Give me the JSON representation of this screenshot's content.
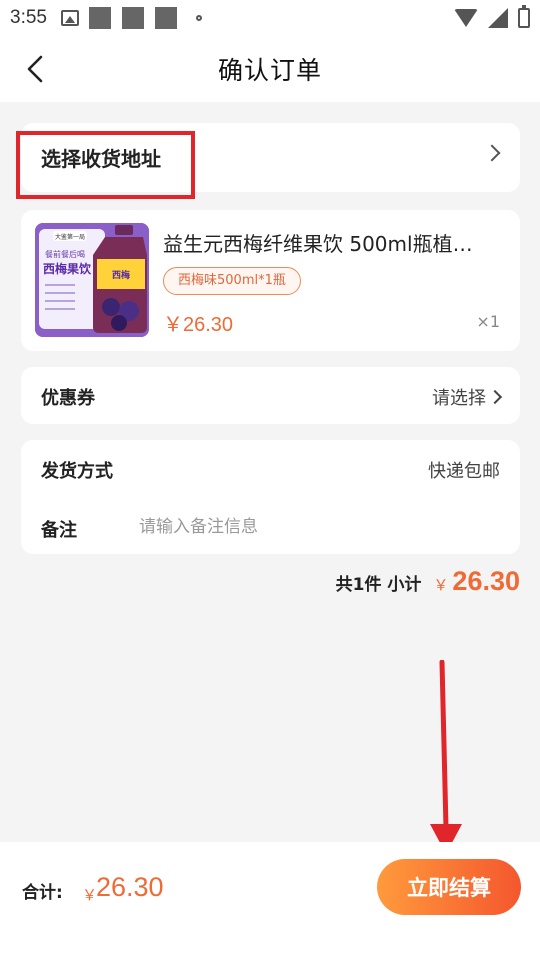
{
  "status_bar": {
    "time": "3:55"
  },
  "header": {
    "title": "确认订单"
  },
  "address": {
    "label": "选择收货地址"
  },
  "product": {
    "name": "益生元西梅纤维果饮 500ml瓶植…",
    "spec": "西梅味500ml*1瓶",
    "price": "￥26.30",
    "quantity": "×1",
    "image_texts": {
      "badge": "大鉴第一局",
      "line1": "餐前餐后喝",
      "line2": "西梅果饮"
    }
  },
  "coupon": {
    "label": "优惠券",
    "value": "请选择"
  },
  "shipping": {
    "label": "发货方式",
    "value": "快递包邮"
  },
  "remark": {
    "label": "备注",
    "placeholder": "请输入备注信息"
  },
  "subtotal": {
    "count_label": "共1件 小计",
    "currency": "￥",
    "amount": "26.30"
  },
  "footer": {
    "total_label": "合计:",
    "currency": "￥",
    "amount": "26.30",
    "checkout_label": "立即结算"
  },
  "colors": {
    "accent": "#f06a36",
    "button_start": "#ff9a3c",
    "button_end": "#f4572e",
    "annotation": "#e0252b"
  }
}
